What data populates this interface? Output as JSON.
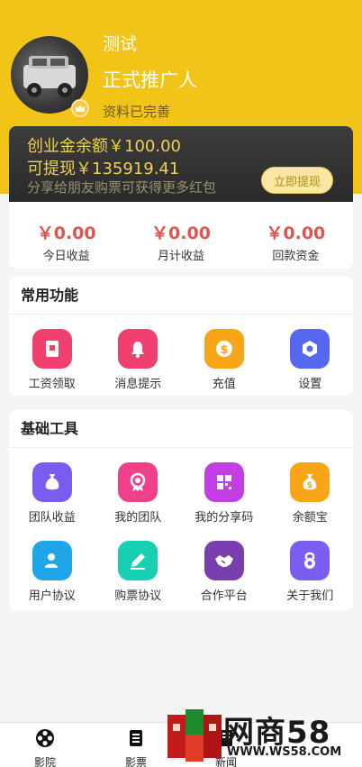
{
  "header": {
    "name": "测试",
    "role": "正式推广人",
    "profile_status": "资料已完善"
  },
  "wallet": {
    "balance_line": "创业金余额￥100.00",
    "withdrawable_line": "可提现￥135919.41",
    "hint": "分享给朋友购票可获得更多红包",
    "withdraw_button": "立即提现"
  },
  "stats": [
    {
      "value": "￥0.00",
      "label": "今日收益"
    },
    {
      "value": "￥0.00",
      "label": "月计收益"
    },
    {
      "value": "￥0.00",
      "label": "回款资金"
    }
  ],
  "common": {
    "title": "常用功能",
    "items": [
      {
        "label": "工资领取",
        "icon": "wallet-icon",
        "color": "#f0406e"
      },
      {
        "label": "消息提示",
        "icon": "bell-icon",
        "color": "#f0406e"
      },
      {
        "label": "充值",
        "icon": "coin-icon",
        "color": "#f8a518"
      },
      {
        "label": "设置",
        "icon": "gear-icon",
        "color": "#5567ef"
      }
    ]
  },
  "tools": {
    "title": "基础工具",
    "items": [
      {
        "label": "团队收益",
        "icon": "money-bag-icon",
        "color": "#7b5cf0"
      },
      {
        "label": "我的团队",
        "icon": "badge-icon",
        "color": "#f0408a"
      },
      {
        "label": "我的分享码",
        "icon": "qr-code-icon",
        "color": "#c43ee6"
      },
      {
        "label": "余额宝",
        "icon": "money-bag-icon",
        "color": "#f8a518"
      },
      {
        "label": "用户协议",
        "icon": "user-agreement-icon",
        "color": "#1fa5e8"
      },
      {
        "label": "购票协议",
        "icon": "pencil-icon",
        "color": "#19cfb3"
      },
      {
        "label": "合作平台",
        "icon": "handshake-icon",
        "color": "#7a3fae"
      },
      {
        "label": "关于我们",
        "icon": "lock-icon",
        "color": "#7b5cf0"
      }
    ]
  },
  "tabbar": [
    {
      "label": "影院",
      "icon": "film-reel-icon"
    },
    {
      "label": "影票",
      "icon": "ticket-icon"
    },
    {
      "label": "新闻",
      "icon": "news-icon"
    }
  ],
  "watermark": {
    "brand": "网商58",
    "url": "WWW.WS58.COM"
  }
}
